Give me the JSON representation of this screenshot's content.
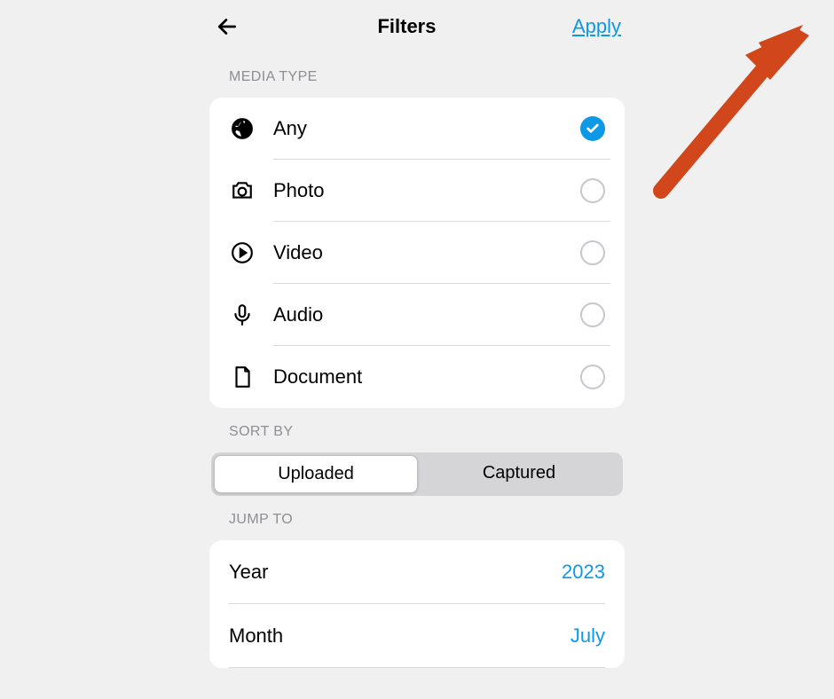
{
  "header": {
    "title": "Filters",
    "apply_label": "Apply"
  },
  "media_type": {
    "section_label": "MEDIA TYPE",
    "options": [
      {
        "icon": "aperture",
        "label": "Any",
        "selected": true
      },
      {
        "icon": "camera",
        "label": "Photo",
        "selected": false
      },
      {
        "icon": "play-circle",
        "label": "Video",
        "selected": false
      },
      {
        "icon": "mic",
        "label": "Audio",
        "selected": false
      },
      {
        "icon": "document",
        "label": "Document",
        "selected": false
      }
    ]
  },
  "sort_by": {
    "section_label": "SORT BY",
    "options": [
      {
        "label": "Uploaded",
        "active": true
      },
      {
        "label": "Captured",
        "active": false
      }
    ]
  },
  "jump_to": {
    "section_label": "JUMP TO",
    "year_label": "Year",
    "year_value": "2023",
    "month_label": "Month",
    "month_value": "July"
  },
  "annotation": {
    "arrow_color": "#d1461a"
  }
}
